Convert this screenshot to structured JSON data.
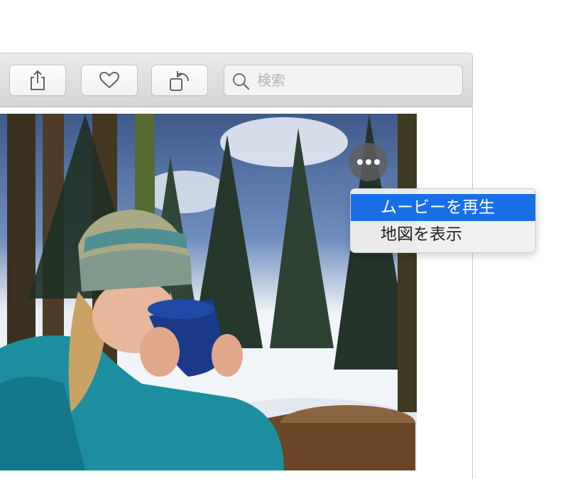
{
  "toolbar": {
    "share_icon": "share-icon",
    "favorite_icon": "heart-icon",
    "rotate_icon": "rotate-icon",
    "search_placeholder": "検索"
  },
  "photo_menu": {
    "more_icon": "more-icon",
    "items": [
      {
        "label": "ムービーを再生",
        "highlighted": true
      },
      {
        "label": "地図を表示",
        "highlighted": false
      }
    ]
  },
  "colors": {
    "highlight": "#1a6fe8",
    "toolbar": "#dcdcdc"
  }
}
